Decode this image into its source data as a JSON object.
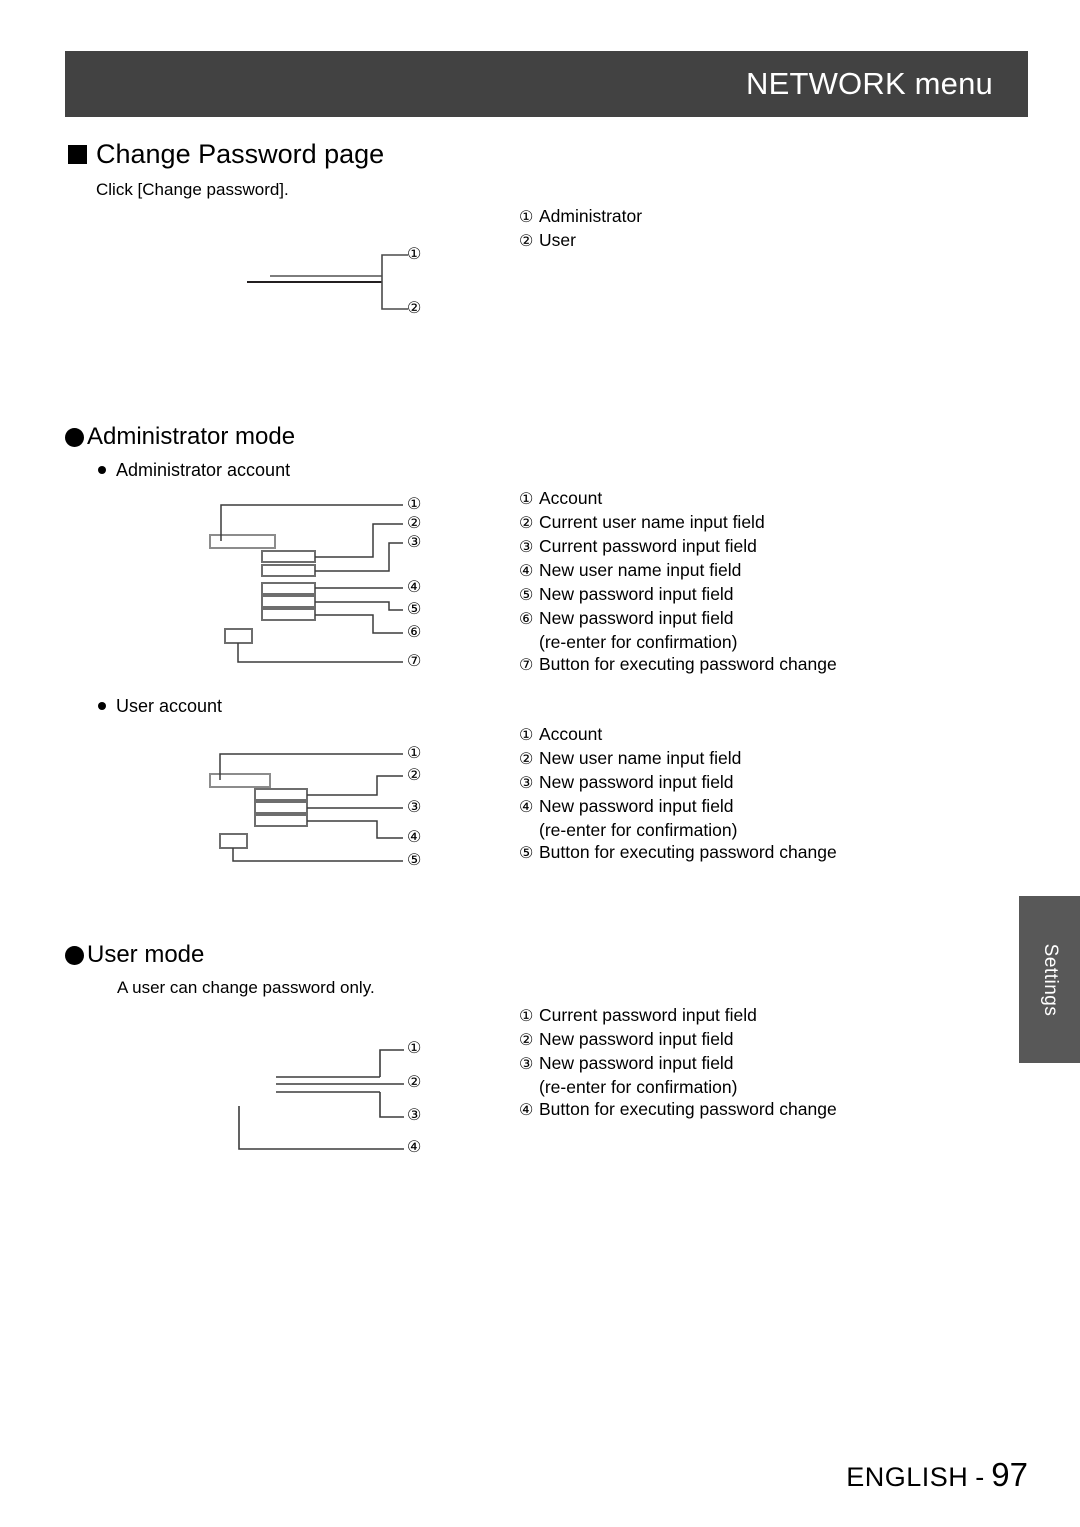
{
  "header": {
    "title": "NETWORK menu"
  },
  "sections": {
    "change_password": {
      "heading": "Change Password page",
      "intro": "Click [Change password].",
      "legend": [
        {
          "num": "①",
          "label": "Administrator"
        },
        {
          "num": "②",
          "label": "User"
        }
      ]
    },
    "administrator_mode": {
      "heading": "Administrator mode",
      "administrator_account": {
        "subheading": "Administrator account",
        "legend": [
          {
            "num": "①",
            "label": "Account"
          },
          {
            "num": "②",
            "label": "Current user name input field"
          },
          {
            "num": "③",
            "label": "Current password input field"
          },
          {
            "num": "④",
            "label": "New user name input field"
          },
          {
            "num": "⑤",
            "label": "New password input field"
          },
          {
            "num": "⑥",
            "label": "New password input field",
            "sub": "(re-enter for confirmation)"
          },
          {
            "num": "⑦",
            "label": "Button for executing password change"
          }
        ]
      },
      "user_account": {
        "subheading": "User account",
        "legend": [
          {
            "num": "①",
            "label": "Account"
          },
          {
            "num": "②",
            "label": "New user name input field"
          },
          {
            "num": "③",
            "label": "New password input field"
          },
          {
            "num": "④",
            "label": "New password input field",
            "sub": "(re-enter for confirmation)"
          },
          {
            "num": "⑤",
            "label": "Button for executing password change"
          }
        ]
      }
    },
    "user_mode": {
      "heading": "User mode",
      "intro": "A user can change password only.",
      "legend": [
        {
          "num": "①",
          "label": "Current password input field"
        },
        {
          "num": "②",
          "label": "New password input field"
        },
        {
          "num": "③",
          "label": "New password input field",
          "sub": "(re-enter for confirmation)"
        },
        {
          "num": "④",
          "label": "Button for executing password change"
        }
      ]
    }
  },
  "figure_callouts": {
    "change_password": [
      "①",
      "②"
    ],
    "administrator_account": [
      "①",
      "②",
      "③",
      "④",
      "⑤",
      "⑥",
      "⑦"
    ],
    "user_account": [
      "①",
      "②",
      "③",
      "④",
      "⑤"
    ],
    "user_mode": [
      "①",
      "②",
      "③",
      "④"
    ]
  },
  "side_tab": {
    "label": "Settings"
  },
  "footer": {
    "language": "ENGLISH",
    "separator": "-",
    "page": "97"
  },
  "colors": {
    "header_bar": "#424242",
    "side_tab": "#585858",
    "rule": "#231f20",
    "field_border": "#808080"
  }
}
